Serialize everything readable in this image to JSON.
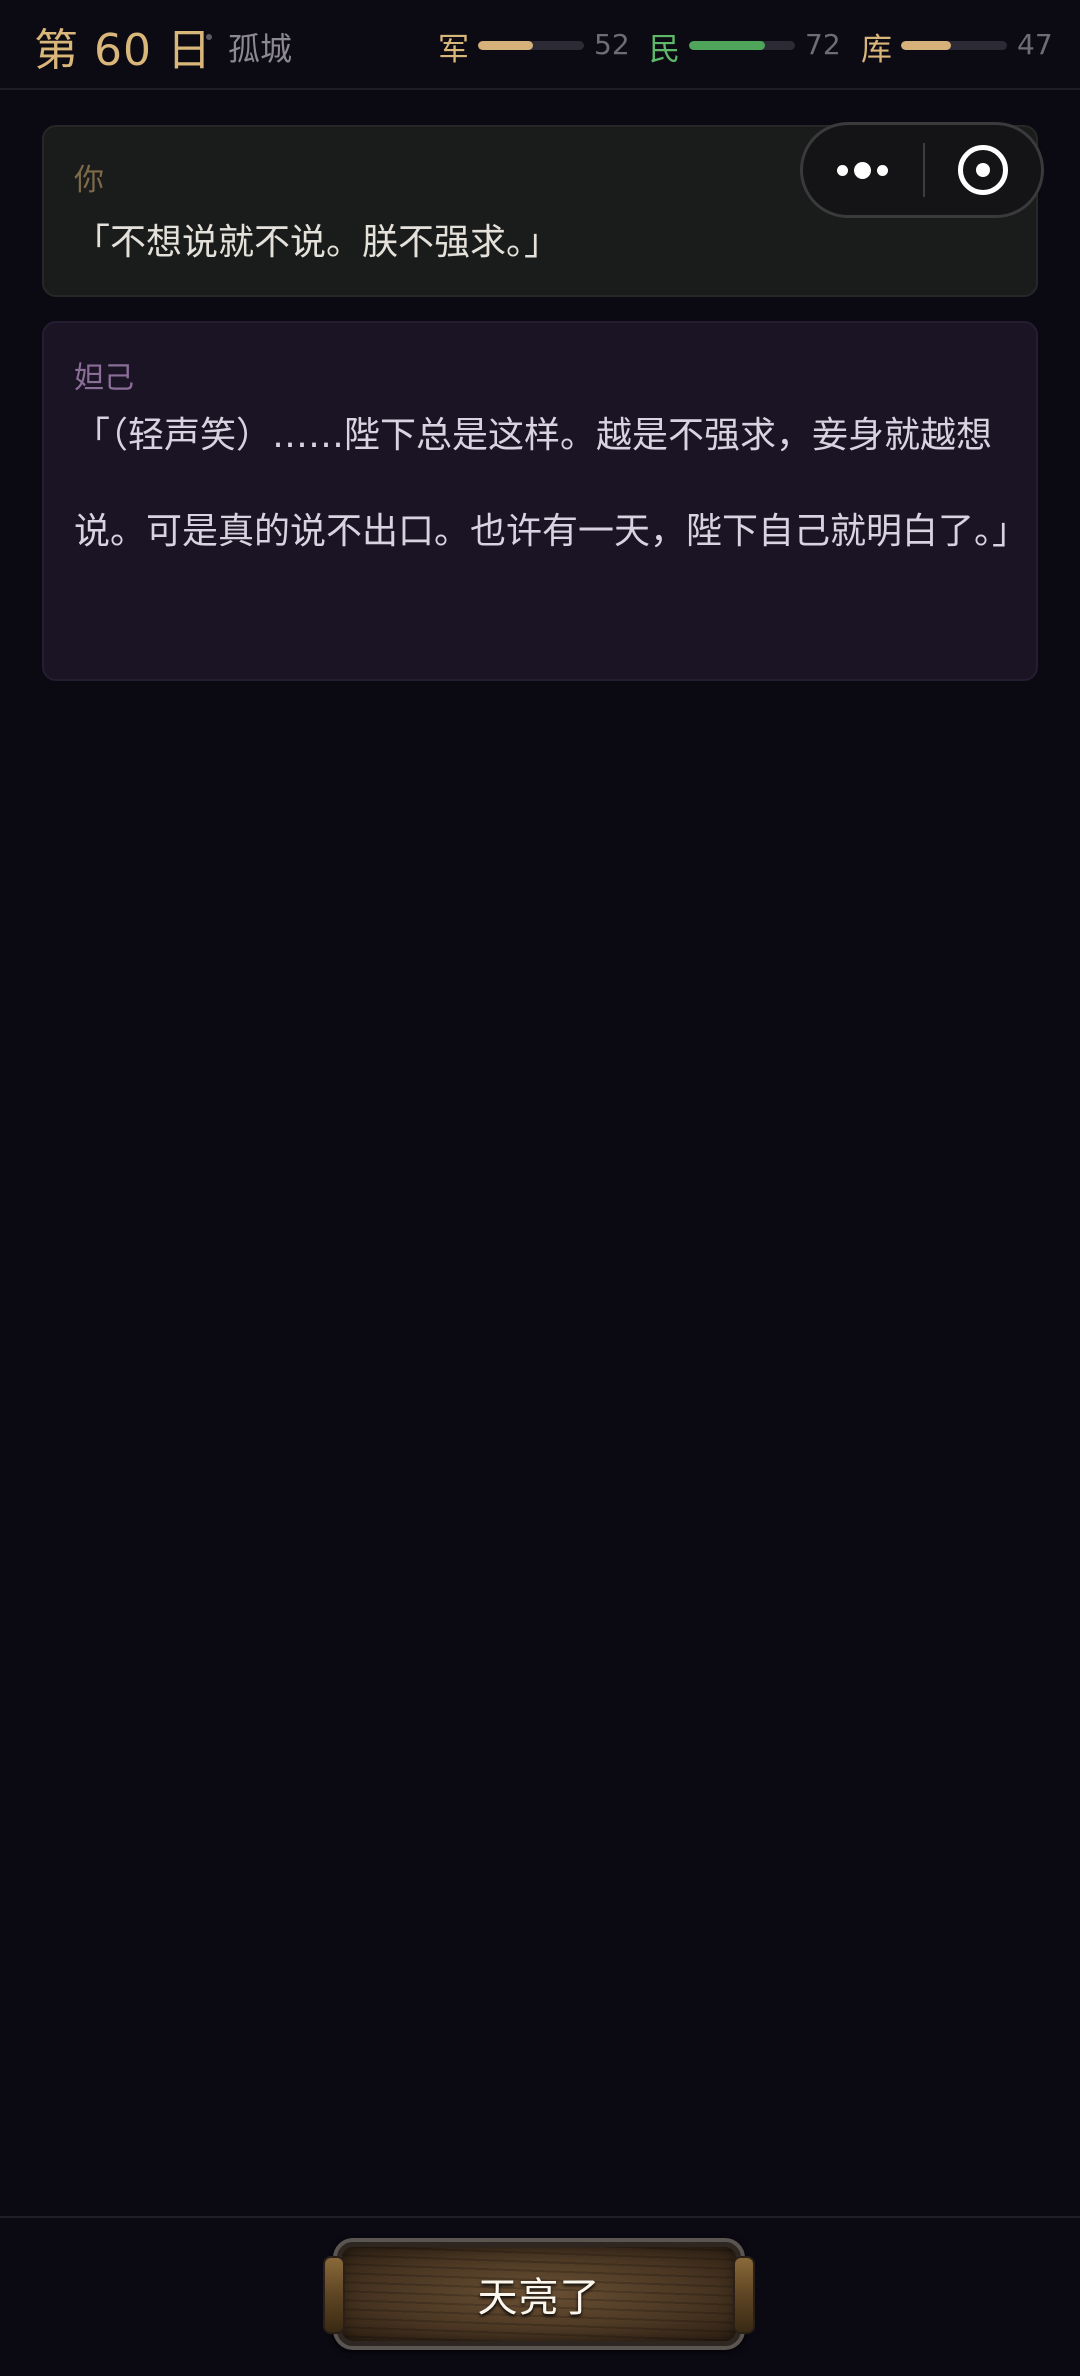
{
  "header": {
    "day": "第 60 日",
    "location": "孤城",
    "stats": [
      {
        "label": "军",
        "value": 52,
        "level": 0.52,
        "label_color": "#d9b77a",
        "bar_color": "#d6b27a"
      },
      {
        "label": "民",
        "value": 72,
        "level": 0.72,
        "label_color": "#5fb86a",
        "bar_color": "#4fa65a"
      },
      {
        "label": "库",
        "value": 47,
        "level": 0.47,
        "label_color": "#d9b77a",
        "bar_color": "#d6b27a"
      }
    ]
  },
  "capsule": {
    "more_icon": "more-dots-icon",
    "close_icon": "target-icon"
  },
  "dialogue": [
    {
      "speaker": "你",
      "text": "「不想说就不说。朕不强求。」"
    },
    {
      "speaker": "妲己",
      "text": "「（轻声笑）……陛下总是这样。越是不强求，妾身就越想说。可是真的说不出口。也许有一天，陛下自己就明白了。」"
    }
  ],
  "action": {
    "label": "天亮了"
  },
  "colors": {
    "background": "#0b0912",
    "accent_gold": "#d9b77a",
    "people_green": "#4fa65a"
  }
}
